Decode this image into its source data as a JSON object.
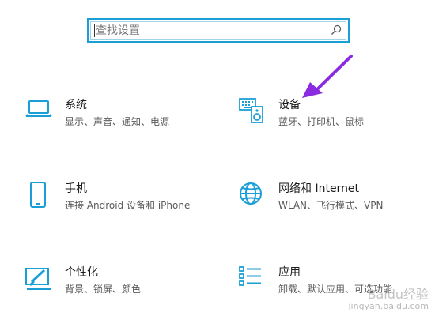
{
  "search": {
    "placeholder": "查找设置"
  },
  "tiles": [
    {
      "title": "系统",
      "desc": "显示、声音、通知、电源",
      "icon": "laptop-icon"
    },
    {
      "title": "设备",
      "desc": "蓝牙、打印机、鼠标",
      "icon": "keyboard-speaker-icon"
    },
    {
      "title": "手机",
      "desc": "连接 Android 设备和 iPhone",
      "icon": "phone-icon"
    },
    {
      "title": "网络和 Internet",
      "desc": "WLAN、飞行模式、VPN",
      "icon": "globe-icon"
    },
    {
      "title": "个性化",
      "desc": "背景、锁屏、颜色",
      "icon": "paintbrush-icon"
    },
    {
      "title": "应用",
      "desc": "卸载、默认应用、可选功能",
      "icon": "app-list-icon"
    }
  ],
  "watermark": {
    "line1": "Baidu经验",
    "line2": "jingyan.baidu.com"
  },
  "colors": {
    "accent": "#1a9ed6",
    "arrow": "#8a2be2"
  }
}
